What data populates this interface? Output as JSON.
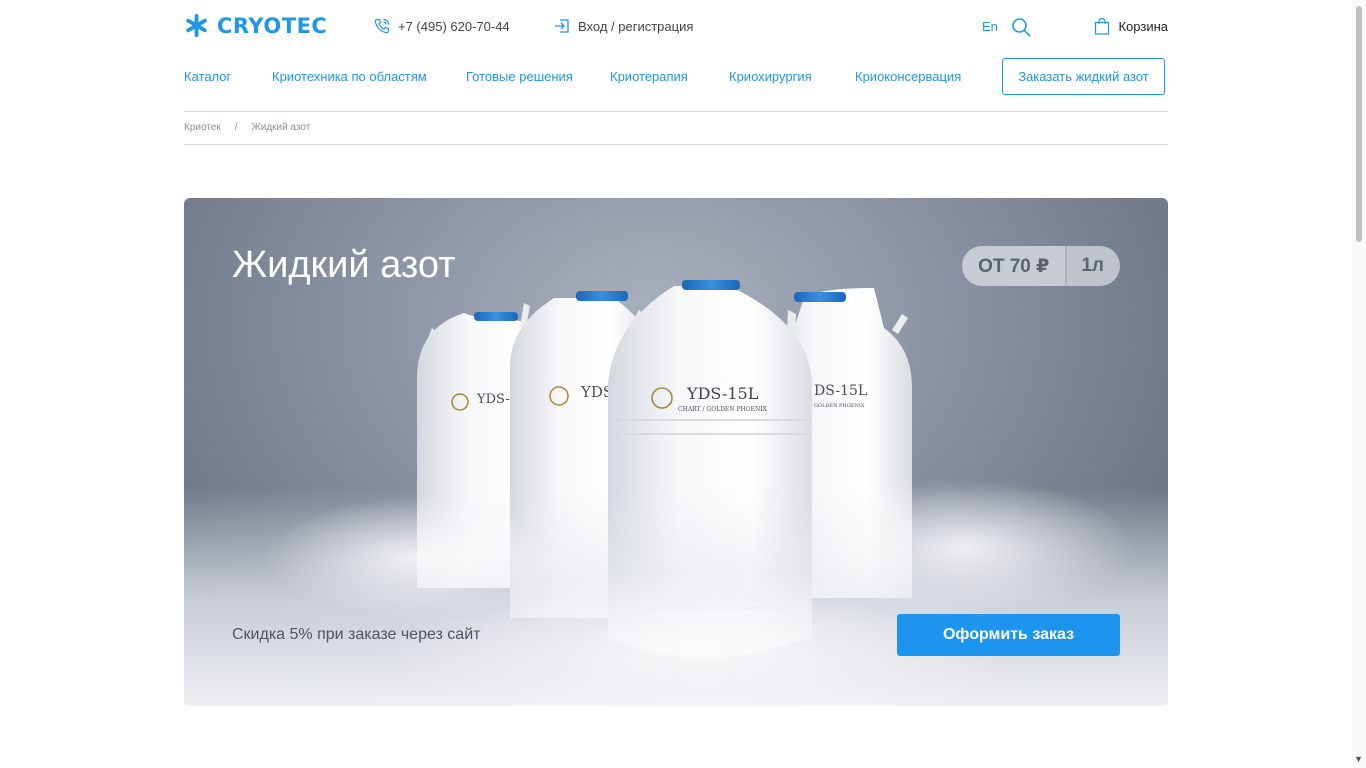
{
  "header": {
    "logo_text": "CRYOTEC",
    "phone": "+7 (495) 620-70-44",
    "login": "Вход / регистрация",
    "lang": "En",
    "cart": "Корзина"
  },
  "nav": {
    "items": [
      "Каталог",
      "Криотехника по областям",
      "Готовые решения",
      "Криотерапия",
      "Криохирургия",
      "Криоконсервация"
    ],
    "order_button": "Заказать жидкий азот"
  },
  "breadcrumb": {
    "home": "Криотек",
    "separator": "/",
    "current": "Жидкий азот"
  },
  "hero": {
    "title": "Жидкий азот",
    "price_from": "ОТ 70 ₽",
    "price_unit": "1л",
    "discount_text": "Скидка 5% при заказе через сайт",
    "cta_label": "Оформить заказ",
    "tank_label_main": "YDS-15L",
    "tank_label_sub": "CHART / GOLDEN PHOENIX",
    "tank_label_left": "YDS-",
    "tank_label_back": "YDS",
    "tank_label_right": "DS-15L",
    "tank_label_right_sub": "GOLDEN PHOENIX"
  },
  "colors": {
    "accent": "#1f96e6",
    "cta": "#1d95ef",
    "hero_bg": "#7b8494"
  }
}
